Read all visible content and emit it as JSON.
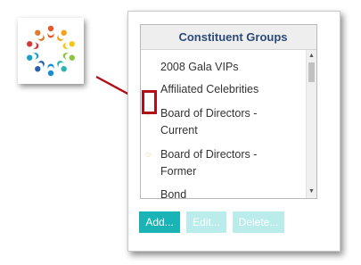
{
  "groups": {
    "title": "Constituent Groups",
    "items": [
      "2008 Gala VIPs",
      "Affiliated Celebrities",
      "Board of Directors -",
      "Current",
      "Board of Directors -",
      "Former",
      "Bond"
    ]
  },
  "buttons": {
    "add": "Add...",
    "edit": "Edit...",
    "delete": "Delete..."
  },
  "colors": {
    "header_text": "#2b4a78",
    "accent": "#1ab3b6",
    "accent_disabled": "#b9eceb",
    "callout": "#b11016"
  },
  "icons": {
    "logo": "people-circle-logo-icon",
    "pointer": "arrow-icon",
    "status": "dotted-circle-icon"
  }
}
